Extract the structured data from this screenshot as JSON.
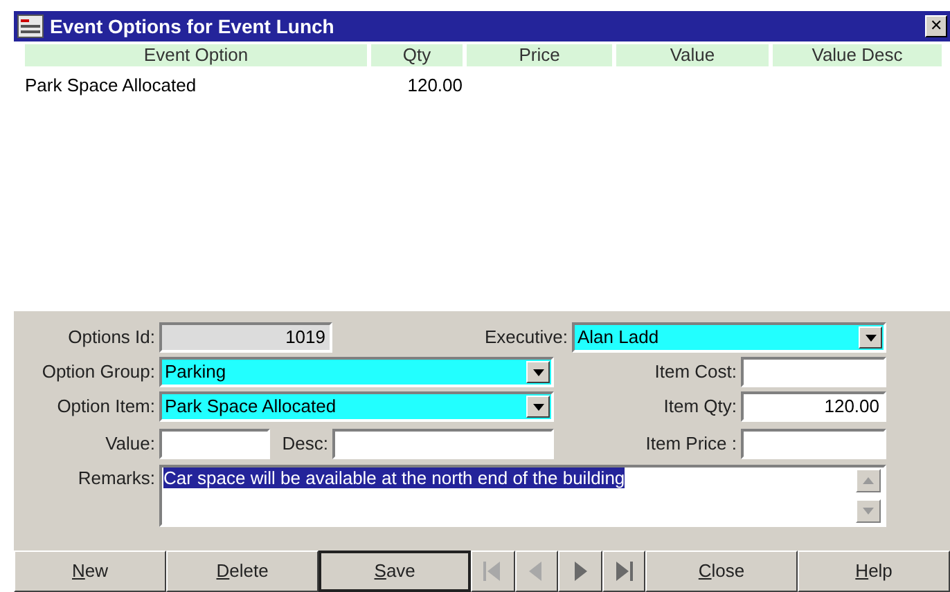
{
  "window": {
    "title": "Event Options for Event Lunch",
    "close": "✕"
  },
  "table": {
    "columns": [
      "Event Option",
      "Qty",
      "Price",
      "Value",
      "Value Desc"
    ],
    "rows": [
      [
        "Park Space Allocated",
        "120.00"
      ]
    ]
  },
  "form": {
    "options_id": {
      "label": "Options Id:",
      "value": "1019"
    },
    "executive": {
      "label": "Executive:",
      "value": "Alan Ladd"
    },
    "option_group": {
      "label": "Option Group:",
      "value": "Parking"
    },
    "item_cost": {
      "label": "Item Cost:"
    },
    "option_item": {
      "label": "Option Item:",
      "value": "Park Space Allocated"
    },
    "item_qty": {
      "label": "Item Qty:",
      "value": "120.00"
    },
    "value": {
      "label": "Value:"
    },
    "desc": {
      "label": "Desc:"
    },
    "item_price": {
      "label": "Item Price :"
    },
    "remarks": {
      "label": "Remarks:",
      "value": "Car space will be available at the north end of the building",
      "text_selected": true
    }
  },
  "buttons": [
    {
      "kind": "text",
      "label": "New",
      "default": false
    },
    {
      "kind": "text",
      "label": "Delete",
      "default": false
    },
    {
      "kind": "text",
      "label": "Save",
      "default": true
    },
    {
      "kind": "nav",
      "disabled": true
    },
    {
      "kind": "nav",
      "disabled": true
    },
    {
      "kind": "nav",
      "disabled": false
    },
    {
      "kind": "nav",
      "disabled": false
    },
    {
      "kind": "text",
      "label": "Close",
      "default": false
    },
    {
      "kind": "text",
      "label": "Help",
      "default": false
    }
  ]
}
